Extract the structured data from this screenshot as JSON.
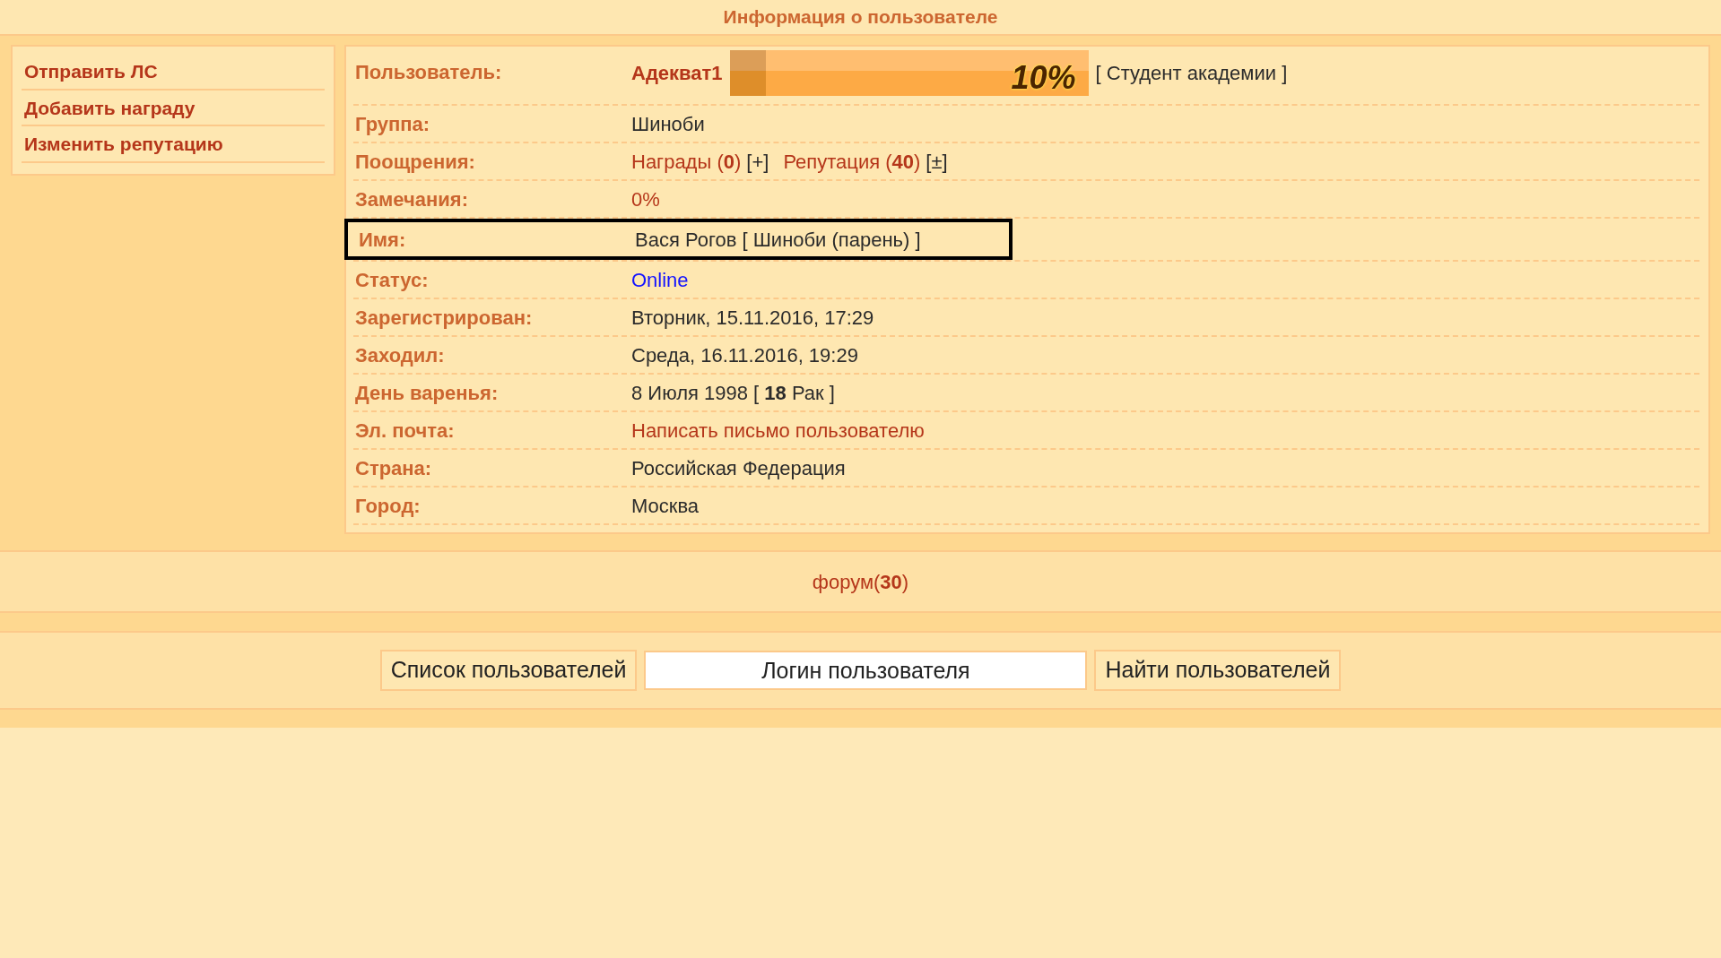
{
  "header": {
    "title": "Информация о пользователе"
  },
  "actions": [
    {
      "label": "Отправить ЛС"
    },
    {
      "label": "Добавить награду"
    },
    {
      "label": "Изменить репутацию"
    }
  ],
  "profile": {
    "user_label": "Пользователь:",
    "username": "Адекват1",
    "progress": {
      "level": 0.1,
      "text": "10%"
    },
    "rank": "[ Студент академии ]",
    "rows": [
      {
        "label": "Группа:",
        "highlighted": false,
        "segments": [
          {
            "kind": "text",
            "text": "Шиноби"
          }
        ]
      },
      {
        "label": "Поощрения:",
        "highlighted": false,
        "segments": [
          {
            "kind": "link",
            "text": "Награды (**0**)"
          },
          {
            "kind": "link",
            "text": "[+]"
          },
          {
            "kind": "link",
            "text": "Репутация (**40**)"
          },
          {
            "kind": "link",
            "text": "[±]"
          }
        ]
      },
      {
        "label": "Замечания:",
        "highlighted": false,
        "segments": [
          {
            "kind": "link",
            "text": "0%"
          }
        ]
      },
      {
        "label": "Имя:",
        "highlighted": true,
        "segments": [
          {
            "kind": "text",
            "text": "Вася Рогов [ Шиноби (парень) ]"
          }
        ]
      },
      {
        "label": "Статус:",
        "highlighted": false,
        "segments": [
          {
            "kind": "status",
            "text": "Online"
          }
        ]
      },
      {
        "label": "Зарегистрирован:",
        "highlighted": false,
        "segments": [
          {
            "kind": "text",
            "text": "Вторник, 15.11.2016, 17:29"
          }
        ]
      },
      {
        "label": "Заходил:",
        "highlighted": false,
        "segments": [
          {
            "kind": "text",
            "text": "Среда, 16.11.2016, 19:29"
          }
        ]
      },
      {
        "label": "День варенья:",
        "highlighted": false,
        "segments": [
          {
            "kind": "text",
            "text": "8 Июля 1998 [ **18** Рак ]"
          }
        ]
      },
      {
        "label": "Эл. почта:",
        "highlighted": false,
        "segments": [
          {
            "kind": "link",
            "text": "Написать письмо пользователю"
          }
        ]
      },
      {
        "label": "Страна:",
        "highlighted": false,
        "segments": [
          {
            "kind": "text",
            "text": "Российская Федерация"
          }
        ]
      },
      {
        "label": "Город:",
        "highlighted": false,
        "segments": [
          {
            "kind": "text",
            "text": "Москва"
          }
        ]
      }
    ]
  },
  "forum_link": "форум(**30**)",
  "search": {
    "list_button": "Список пользователей",
    "placeholder": "Логин пользователя",
    "find_button": "Найти пользователей"
  }
}
